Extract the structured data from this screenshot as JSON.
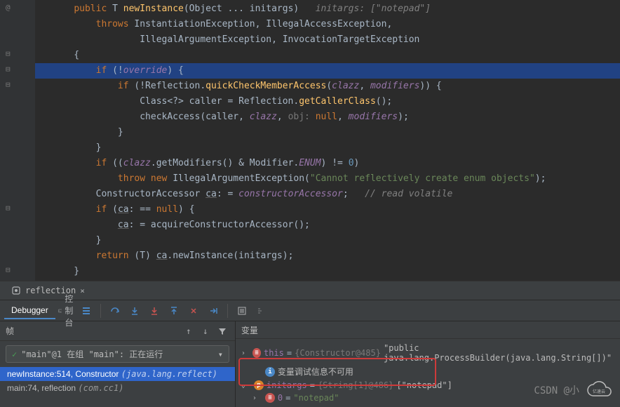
{
  "editor": {
    "lines": [
      {
        "indent": 2,
        "tokens": [
          [
            "kw",
            "public "
          ],
          [
            "type",
            "T "
          ],
          [
            "method",
            "newInstance"
          ],
          [
            "",
            "(Object ... initargs)   "
          ],
          [
            "comment",
            "initargs: [\"notepad\"]"
          ]
        ]
      },
      {
        "indent": 3,
        "tokens": [
          [
            "kw",
            "throws "
          ],
          [
            "",
            "InstantiationException, IllegalAccessException,"
          ]
        ]
      },
      {
        "indent": 5,
        "tokens": [
          [
            "",
            "IllegalArgumentException, InvocationTargetException"
          ]
        ]
      },
      {
        "indent": 2,
        "tokens": [
          [
            "",
            "{"
          ]
        ]
      },
      {
        "indent": 3,
        "highlighted": true,
        "tokens": [
          [
            "kw",
            "if "
          ],
          [
            "",
            "(!"
          ],
          [
            "field",
            "override"
          ],
          [
            "",
            ") {"
          ]
        ]
      },
      {
        "indent": 4,
        "tokens": [
          [
            "kw",
            "if "
          ],
          [
            "",
            "(!Reflection."
          ],
          [
            "method",
            "quickCheckMemberAccess"
          ],
          [
            "",
            "("
          ],
          [
            "field",
            "clazz"
          ],
          [
            "",
            ", "
          ],
          [
            "field",
            "modifiers"
          ],
          [
            "",
            ")) {"
          ]
        ]
      },
      {
        "indent": 5,
        "tokens": [
          [
            "",
            "Class<?> caller = Reflection."
          ],
          [
            "method",
            "getCallerClass"
          ],
          [
            "",
            "();"
          ]
        ]
      },
      {
        "indent": 5,
        "tokens": [
          [
            "",
            "checkAccess(caller, "
          ],
          [
            "field",
            "clazz"
          ],
          [
            "",
            ", "
          ],
          [
            "param-hint",
            "obj: "
          ],
          [
            "kw",
            "null"
          ],
          [
            "",
            ", "
          ],
          [
            "field",
            "modifiers"
          ],
          [
            "",
            ");"
          ]
        ]
      },
      {
        "indent": 4,
        "tokens": [
          [
            "",
            "}"
          ]
        ]
      },
      {
        "indent": 3,
        "tokens": [
          [
            "",
            "}"
          ]
        ]
      },
      {
        "indent": 3,
        "tokens": [
          [
            "kw",
            "if "
          ],
          [
            "",
            "(("
          ],
          [
            "field",
            "clazz"
          ],
          [
            "",
            ".getModifiers() & Modifier."
          ],
          [
            "enum-const",
            "ENUM"
          ],
          [
            "",
            ") != "
          ],
          [
            "num",
            "0"
          ],
          [
            "",
            ")"
          ]
        ]
      },
      {
        "indent": 4,
        "tokens": [
          [
            "kw",
            "throw new "
          ],
          [
            "",
            "IllegalArgumentException("
          ],
          [
            "str",
            "\"Cannot reflectively create enum objects\""
          ],
          [
            "",
            ");"
          ]
        ]
      },
      {
        "indent": 3,
        "tokens": [
          [
            "",
            "ConstructorAccessor "
          ],
          [
            "underline",
            "ca"
          ],
          [
            "",
            ": = "
          ],
          [
            "field",
            "constructorAccessor"
          ],
          [
            "",
            ";   "
          ],
          [
            "comment",
            "// read volatile"
          ]
        ]
      },
      {
        "indent": 3,
        "tokens": [
          [
            "kw",
            "if "
          ],
          [
            "",
            "("
          ],
          [
            "underline",
            "ca"
          ],
          [
            "",
            ": == "
          ],
          [
            "kw",
            "null"
          ],
          [
            "",
            ") {"
          ]
        ]
      },
      {
        "indent": 4,
        "tokens": [
          [
            "underline",
            "ca"
          ],
          [
            "",
            ": = acquireConstructorAccessor();"
          ]
        ]
      },
      {
        "indent": 3,
        "tokens": [
          [
            "",
            "}"
          ]
        ]
      },
      {
        "indent": 3,
        "tokens": [
          [
            "kw",
            "return "
          ],
          [
            "",
            "("
          ],
          [
            "type",
            "T"
          ],
          [
            "",
            ") "
          ],
          [
            "underline",
            "ca"
          ],
          [
            "",
            ".newInstance(initargs);"
          ]
        ]
      },
      {
        "indent": 2,
        "tokens": [
          [
            "",
            "}"
          ]
        ]
      }
    ],
    "breakpoint_marker": "@"
  },
  "tab": {
    "label": "reflection"
  },
  "toolbar": {
    "debugger_tab": "Debugger",
    "console_tab": "控制台"
  },
  "frames": {
    "header": "帧",
    "selector_text": "\"main\"@1 在组 \"main\": 正在运行",
    "items": [
      {
        "text": "newInstance:514, Constructor ",
        "pkg": "(java.lang.reflect)",
        "selected": true
      },
      {
        "text": "main:74, reflection ",
        "pkg": "(com.cc1)",
        "selected": false
      }
    ]
  },
  "vars": {
    "header": "变量",
    "rows": [
      {
        "depth": 0,
        "expand": "›",
        "icon": "red",
        "iconChar": "≡",
        "name": "this",
        "eq": " = ",
        "type": "{Constructor@485}",
        "val": " \"public java.lang.ProcessBuilder(java.lang.String[])\""
      },
      {
        "depth": 1,
        "expand": "",
        "icon": "blue",
        "iconChar": "i",
        "name": "",
        "eq": "",
        "type": "",
        "val": "变量调试信息不可用"
      },
      {
        "depth": 0,
        "expand": "⌄",
        "icon": "orange",
        "iconChar": "p",
        "name": "initargs",
        "eq": " = ",
        "type": "{String[1]@486}",
        "val": " [\"notepad\"]"
      },
      {
        "depth": 1,
        "expand": "›",
        "icon": "red",
        "iconChar": "≡",
        "name": "0",
        "eq": " = ",
        "type": "",
        "valStr": "\"notepad\""
      }
    ]
  },
  "watermark": {
    "text": "CSDN @小",
    "brand": "亿速云"
  }
}
